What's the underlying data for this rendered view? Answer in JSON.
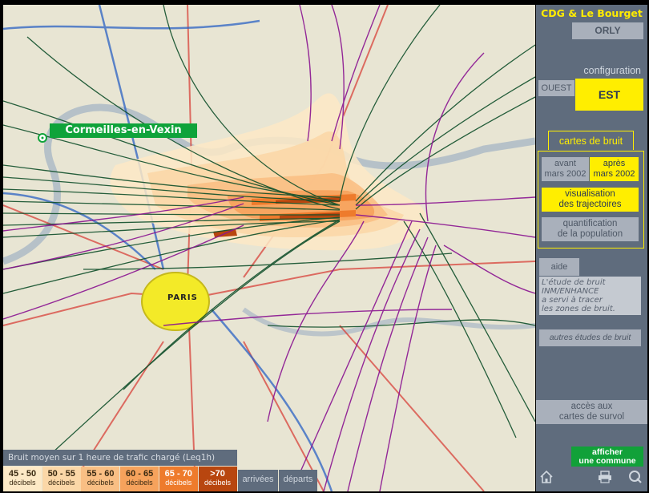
{
  "map": {
    "commune_label": "Cormeilles-en-Vexin",
    "city_label": "PARIS"
  },
  "panel": {
    "title": "CDG & Le Bourget",
    "orly": "ORLY",
    "configuration_label": "configuration",
    "ouest": "OUEST",
    "est": "EST",
    "cartes_de_bruit": "cartes de bruit",
    "avant_line1": "avant",
    "avant_line2": "mars 2002",
    "apres_line1": "après",
    "apres_line2": "mars 2002",
    "visualisation_line1": "visualisation",
    "visualisation_line2": "des trajectoires",
    "quantification_line1": "quantification",
    "quantification_line2": "de la population",
    "aide": "aide",
    "help_line1": "L'étude de bruit",
    "help_line2": "INM/ENHANCE",
    "help_line3": "a servi à tracer",
    "help_line4": "les zones de bruit.",
    "autres_etudes": "autres études de bruit",
    "acces_line1": "accès aux",
    "acces_line2": "cartes de survol",
    "afficher_line1": "afficher",
    "afficher_line2": "une commune"
  },
  "legend": {
    "title": "Bruit moyen sur 1 heure de trafic chargé (Leq1h)",
    "unit": "décibels",
    "bands": [
      {
        "label": "45 - 50",
        "color": "#fde9c6"
      },
      {
        "label": "50 - 55",
        "color": "#fbd7a7"
      },
      {
        "label": "55 - 60",
        "color": "#f9bf84"
      },
      {
        "label": "60 - 65",
        "color": "#f6a25c"
      },
      {
        "label": "65 - 70",
        "color": "#ee7b2c"
      },
      {
        "label": ">70",
        "color": "#b8460f"
      }
    ],
    "arrivees": "arrivées",
    "departs": "départs"
  },
  "colors": {
    "arrivals": "#0f4f2a",
    "departures": "#8a1491",
    "accent_yellow": "#ffee00",
    "panel_bg": "#5f6c7d"
  }
}
